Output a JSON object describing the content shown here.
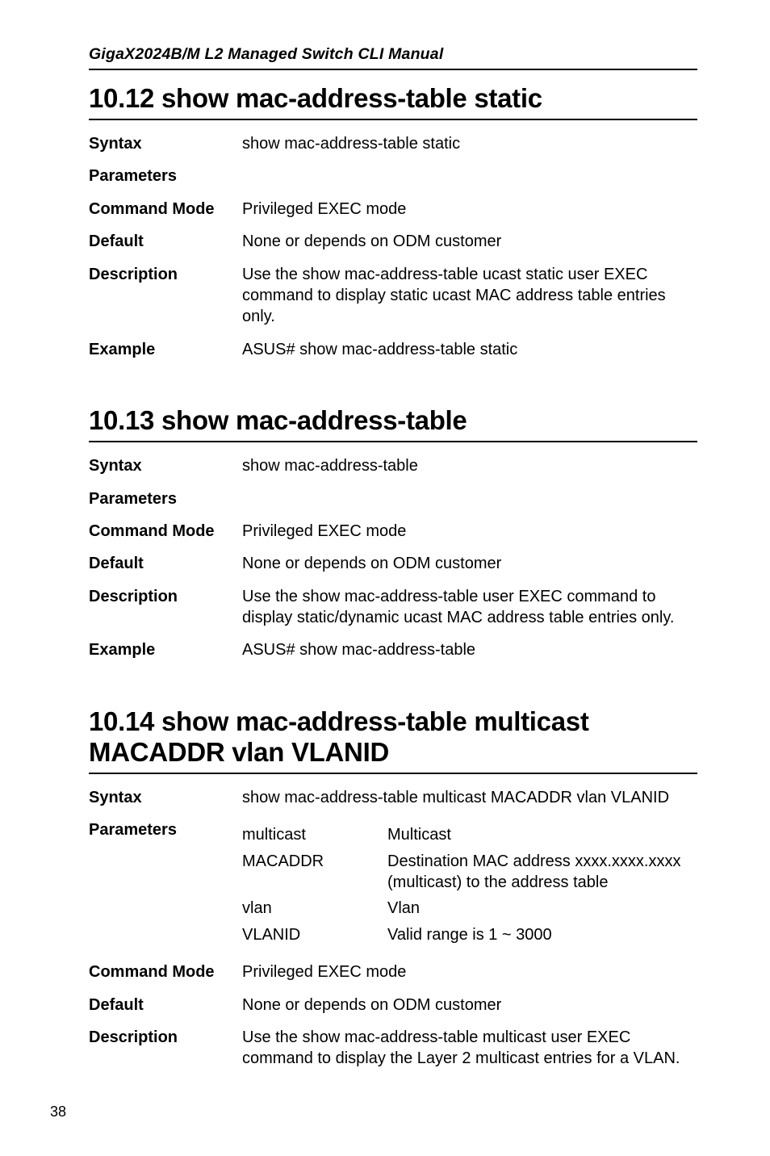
{
  "running_header": "GigaX2024B/M L2 Managed Switch CLI Manual",
  "page_number": "38",
  "sections": [
    {
      "title": "10.12  show mac-address-table static",
      "rows": [
        {
          "label": "Syntax",
          "value": "show mac-address-table static"
        },
        {
          "label": "Parameters",
          "value": ""
        },
        {
          "label": "Command Mode",
          "value": "Privileged EXEC mode"
        },
        {
          "label": "Default",
          "value": "None or depends on ODM customer"
        },
        {
          "label": "Description",
          "value": "Use the show mac-address-table ucast static user EXEC command to display static ucast MAC address table entries only."
        },
        {
          "label": "Example",
          "value": "ASUS# show mac-address-table static"
        }
      ]
    },
    {
      "title": "10.13  show mac-address-table",
      "rows": [
        {
          "label": "Syntax",
          "value": "show mac-address-table"
        },
        {
          "label": "Parameters",
          "value": ""
        },
        {
          "label": "Command Mode",
          "value": "Privileged EXEC mode"
        },
        {
          "label": "Default",
          "value": "None or depends on ODM customer"
        },
        {
          "label": "Description",
          "value": "Use the show mac-address-table user EXEC command to display static/dynamic ucast MAC address table entries only."
        },
        {
          "label": "Example",
          "value": "ASUS# show mac-address-table"
        }
      ]
    },
    {
      "title": "10.14  show mac-address-table multicast MACADDR vlan VLANID",
      "rows": [
        {
          "label": "Syntax",
          "value": "show mac-address-table multicast MACADDR vlan VLANID"
        },
        {
          "label": "Parameters",
          "params": [
            {
              "key": "multicast",
              "desc": "Multicast"
            },
            {
              "key": "MACADDR",
              "desc": "Destination MAC address xxxx.xxxx.xxxx (multicast) to the address table"
            },
            {
              "key": "vlan",
              "desc": "Vlan"
            },
            {
              "key": "VLANID",
              "desc": "Valid range is 1 ~ 3000"
            }
          ]
        },
        {
          "label": "Command Mode",
          "value": "Privileged EXEC mode"
        },
        {
          "label": "Default",
          "value": "None or depends on ODM customer"
        },
        {
          "label": "Description",
          "value": "Use the show mac-address-table multicast user EXEC command to display the Layer 2 multicast entries for a VLAN."
        }
      ]
    }
  ]
}
